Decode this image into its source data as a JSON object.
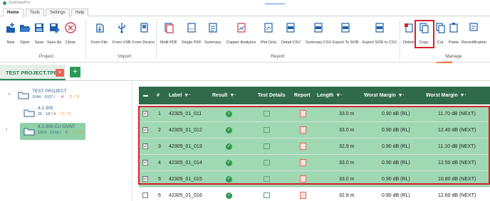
{
  "app": {
    "title": "TestDataPro"
  },
  "menu_tabs": [
    "Home",
    "Tools",
    "Settings",
    "Help"
  ],
  "ribbon": {
    "project": {
      "label": "Project",
      "buttons": [
        "New",
        "Open",
        "Save",
        "Save As",
        "Close"
      ]
    },
    "import": {
      "label": "Import",
      "buttons": [
        "From File",
        "From USB",
        "From Device"
      ]
    },
    "report": {
      "label": "Report",
      "buttons": [
        "Multi PDF",
        "Single PDF",
        "Summary",
        "Copper Analytics",
        "Plot Only",
        "Detail CSV",
        "Summary CSV",
        "Export To SOR",
        "Export SOR to CSV"
      ]
    },
    "manage": {
      "label": "Manage",
      "buttons": [
        "Delete",
        "Copy",
        "Cut",
        "Paste",
        "Recertification"
      ]
    }
  },
  "project_tab": {
    "name": "TEST PROJECT.TPP",
    "close_glyph": "×",
    "add_glyph": "+"
  },
  "tree": [
    {
      "name": "TEST PROJECT",
      "count_total": "1044 · 1037 /",
      "count_fail": "4",
      "count_warn": "· *3 / *0"
    },
    {
      "name": "4.2.305",
      "count_total": "25 · 18 /",
      "count_fail": "4",
      "count_warn": "· *3 / *0"
    },
    {
      "name": "4.2.305 CU OVNT",
      "count_total": "1019 · 1019 /",
      "count_fail": "0",
      "count_warn": "· *0 / *0"
    }
  ],
  "table": {
    "headers": [
      "#",
      "Label",
      "Result",
      "Test Details",
      "Report",
      "Length",
      "Worst Margin",
      "Worst Margin"
    ],
    "rows": [
      {
        "num": "1",
        "label": "42305_01_011",
        "length": "33.0 m",
        "wm1": "0.90 dB (RL)",
        "wm2": "11.70 dB (NEXT)",
        "checked": "☑"
      },
      {
        "num": "2",
        "label": "42305_01_012",
        "length": "33.0 m",
        "wm1": "0.90 dB (RL)",
        "wm2": "12.40 dB (NEXT)",
        "checked": "☑"
      },
      {
        "num": "3",
        "label": "42305_01_013",
        "length": "32.9 m",
        "wm1": "0.90 dB (RL)",
        "wm2": "11.10 dB (NEXT)",
        "checked": "☑"
      },
      {
        "num": "4",
        "label": "42305_01_014",
        "length": "33.0 m",
        "wm1": "0.90 dB (RL)",
        "wm2": "12.50 dB (NEXT)",
        "checked": "☑"
      },
      {
        "num": "5",
        "label": "42305_01_015",
        "length": "33.0 m",
        "wm1": "0.90 dB (RL)",
        "wm2": "10.80 dB (NEXT)",
        "checked": "☑"
      },
      {
        "num": "6",
        "label": "42305_01_016",
        "length": "32.9 m",
        "wm1": "0.90 dB (RL)",
        "wm2": "12.60 dB (NEXT)",
        "checked": ""
      }
    ]
  },
  "colors": {
    "accent": "#2e9a5a",
    "header": "#2f6b4a",
    "selected_row": "#9fd8b3",
    "highlight": "#d6202a",
    "arrow": "#f07c40"
  }
}
